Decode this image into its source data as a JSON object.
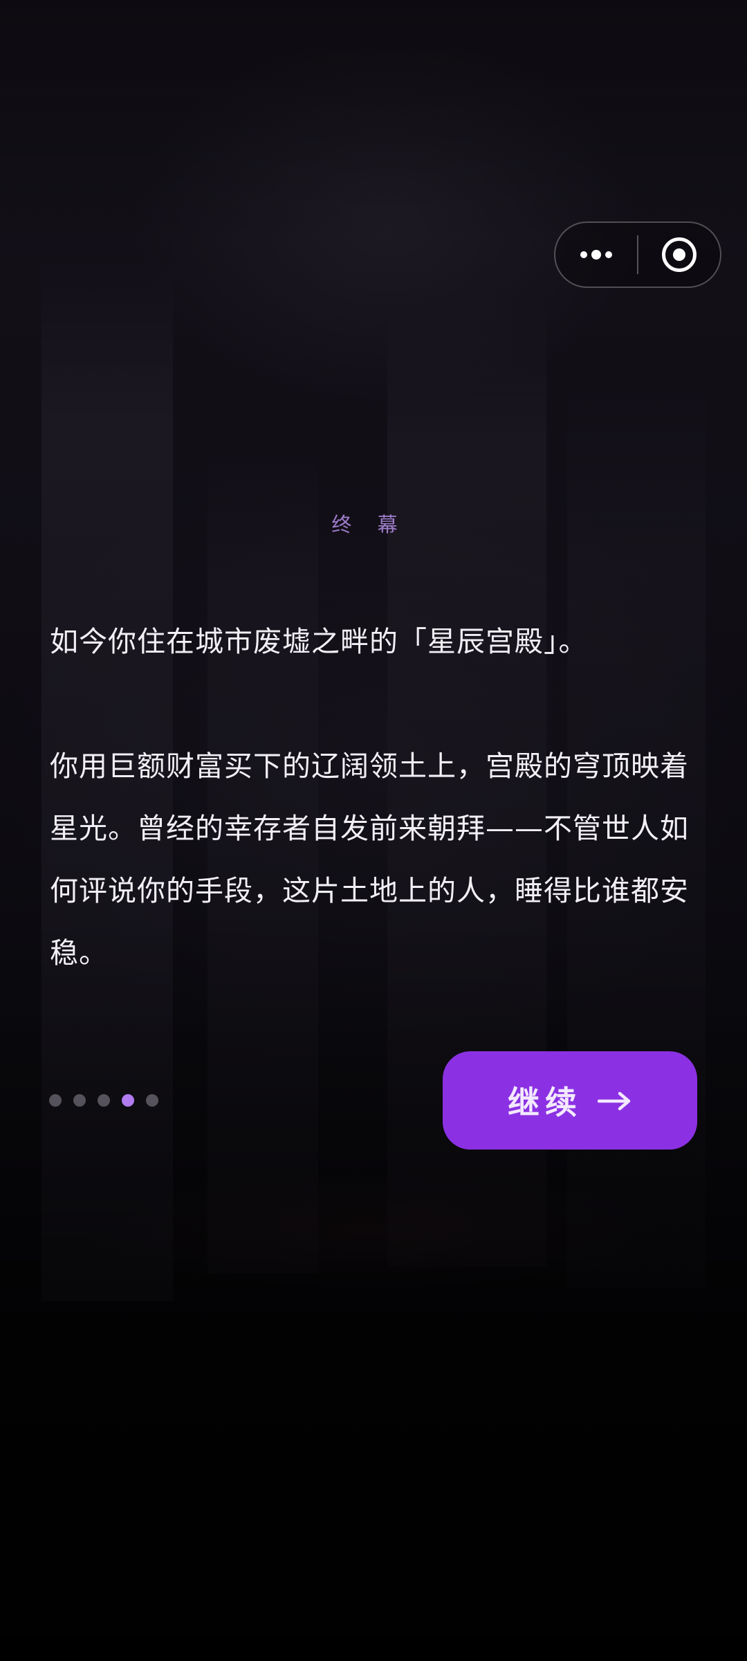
{
  "capsule": {
    "more_icon": "more-dots-icon",
    "close_icon": "target-close-icon"
  },
  "content": {
    "chapter_label": "终 幕",
    "paragraphs": [
      "如今你住在城市废墟之畔的「星辰宫殿」。",
      "你用巨额财富买下的辽阔领土上，宫殿的穹顶映着星光。曾经的幸存者自发前来朝拜——不管世人如何评说你的手段，这片土地上的人，睡得比谁都安稳。"
    ]
  },
  "progress": {
    "total": 5,
    "current": 4
  },
  "actions": {
    "continue_label": "继续",
    "continue_icon": "arrow-right-icon"
  },
  "colors": {
    "accent": "#8b31e3",
    "active_dot": "#b07cf0",
    "chapter_text": "#9d7cc9",
    "body_text": "#f2eff5"
  }
}
